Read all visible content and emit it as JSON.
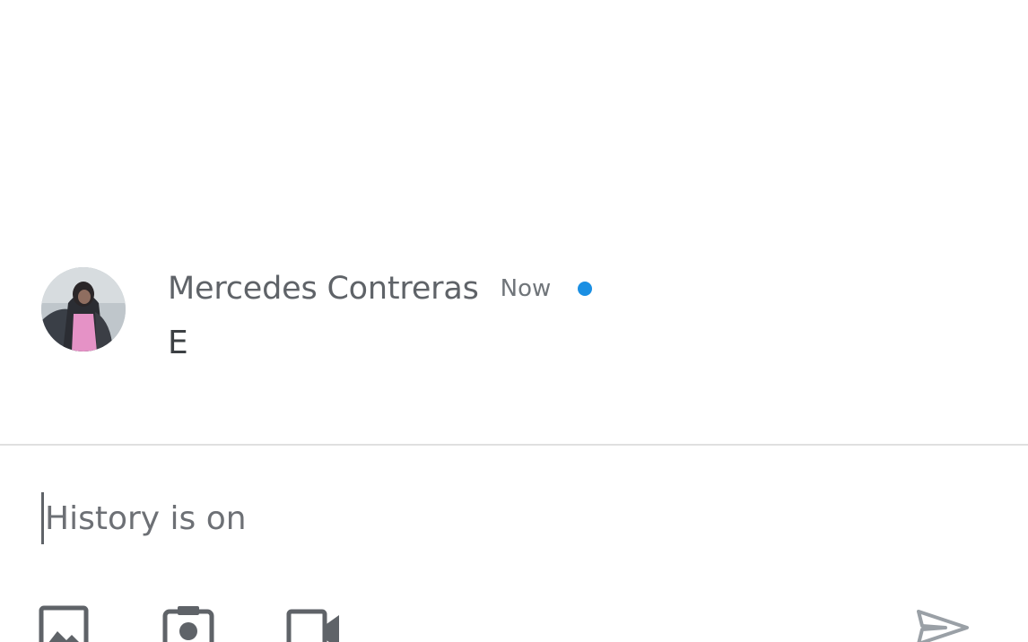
{
  "message": {
    "sender": "Mercedes Contreras",
    "time": "Now",
    "body": "E",
    "unread": true
  },
  "composer": {
    "placeholder": "History is on",
    "value": ""
  },
  "toolbar": {
    "icons": [
      "image-icon",
      "camera-icon",
      "video-icon",
      "send-icon"
    ]
  },
  "colors": {
    "unread_dot": "#1a8fe3",
    "text_secondary": "#5f6368",
    "divider": "#e0e0e0"
  }
}
